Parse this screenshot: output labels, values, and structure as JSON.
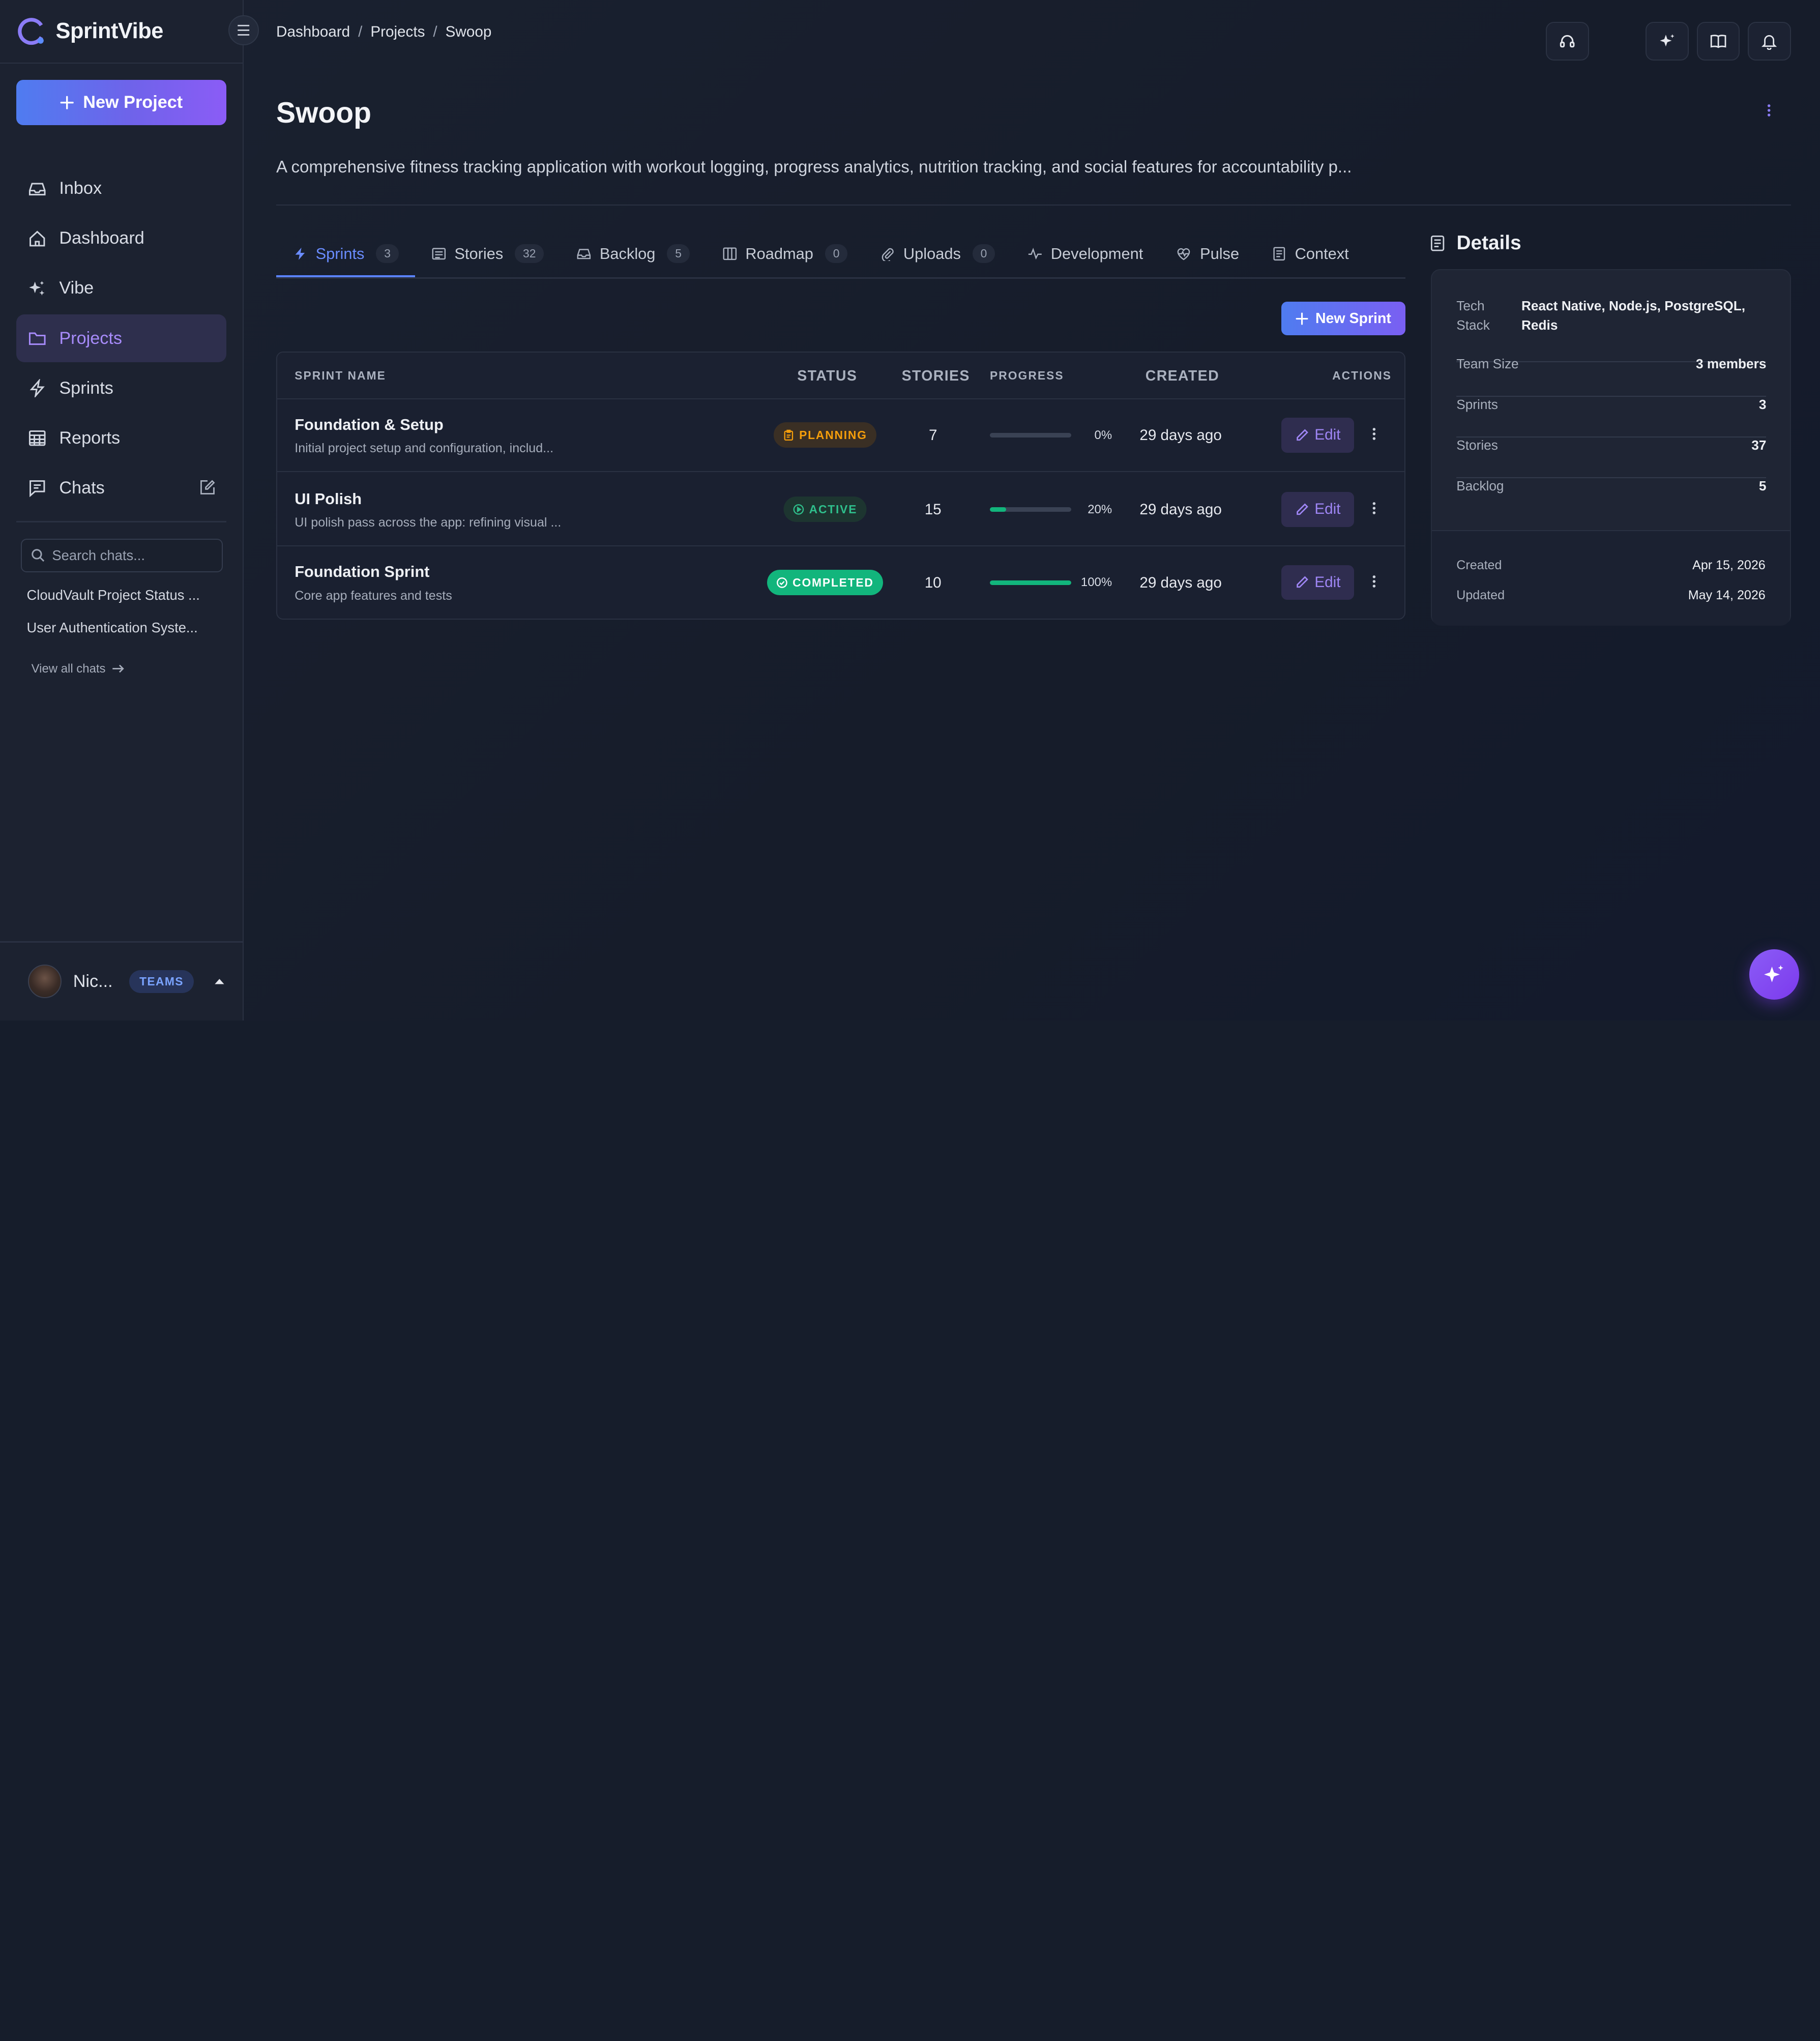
{
  "app": {
    "name": "SprintVibe"
  },
  "sidebar": {
    "new_project_label": "New Project",
    "items": [
      {
        "label": "Inbox",
        "icon": "inbox-icon"
      },
      {
        "label": "Dashboard",
        "icon": "home-icon"
      },
      {
        "label": "Vibe",
        "icon": "sparkles-icon"
      },
      {
        "label": "Projects",
        "icon": "folder-icon",
        "active": true
      },
      {
        "label": "Sprints",
        "icon": "lightning-icon"
      },
      {
        "label": "Reports",
        "icon": "table-icon"
      },
      {
        "label": "Chats",
        "icon": "chat-icon"
      }
    ],
    "search_placeholder": "Search chats...",
    "chats": [
      "CloudVault Project Status ...",
      "User Authentication Syste..."
    ],
    "view_all_label": "View all chats",
    "user": {
      "name": "Nic...",
      "badge": "TEAMS"
    }
  },
  "breadcrumb": [
    "Dashboard",
    "Projects",
    "Swoop"
  ],
  "project": {
    "title": "Swoop",
    "description": "A comprehensive fitness tracking application with workout logging, progress analytics, nutrition tracking, and social features for accountability p..."
  },
  "tabs": [
    {
      "label": "Sprints",
      "count": "3",
      "icon": "lightning-icon",
      "active": true
    },
    {
      "label": "Stories",
      "count": "32",
      "icon": "list-icon"
    },
    {
      "label": "Backlog",
      "count": "5",
      "icon": "inbox-icon"
    },
    {
      "label": "Roadmap",
      "count": "0",
      "icon": "columns-icon"
    },
    {
      "label": "Uploads",
      "count": "0",
      "icon": "paperclip-icon"
    },
    {
      "label": "Development",
      "icon": "activity-icon"
    },
    {
      "label": "Pulse",
      "icon": "heart-pulse-icon"
    },
    {
      "label": "Context",
      "icon": "document-icon"
    }
  ],
  "new_sprint_label": "New Sprint",
  "table": {
    "headers": {
      "name": "SPRINT NAME",
      "status": "STATUS",
      "stories": "STORIES",
      "progress": "PROGRESS",
      "created": "CREATED",
      "actions": "ACTIONS"
    },
    "rows": [
      {
        "name": "Foundation & Setup",
        "desc": "Initial project setup and configuration, includ...",
        "status": "PLANNING",
        "status_kind": "planning",
        "stories": "7",
        "progress": 0,
        "progress_label": "0%",
        "created": "29 days ago",
        "edit": "Edit"
      },
      {
        "name": "UI Polish",
        "desc": "UI polish pass across the app: refining visual ...",
        "status": "ACTIVE",
        "status_kind": "active",
        "stories": "15",
        "progress": 20,
        "progress_label": "20%",
        "created": "29 days ago",
        "edit": "Edit"
      },
      {
        "name": "Foundation Sprint",
        "desc": "Core app features and tests",
        "status": "COMPLETED",
        "status_kind": "completed",
        "stories": "10",
        "progress": 100,
        "progress_label": "100%",
        "created": "29 days ago",
        "edit": "Edit"
      }
    ]
  },
  "details": {
    "title": "Details",
    "tech_stack_label": "Tech Stack",
    "tech_stack": "React Native, Node.js, PostgreSQL, Redis",
    "rows": [
      {
        "label": "Team Size",
        "value": "3 members"
      },
      {
        "label": "Sprints",
        "value": "3"
      },
      {
        "label": "Stories",
        "value": "37"
      },
      {
        "label": "Backlog",
        "value": "5"
      }
    ],
    "created_label": "Created",
    "created": "Apr 15, 2026",
    "updated_label": "Updated",
    "updated": "May 14, 2026"
  },
  "colors": {
    "accent": "#6a8cff",
    "purple": "#8b5cf6",
    "planning": "#f59e0b",
    "active": "#2fbf8c",
    "completed": "#12b57c"
  }
}
